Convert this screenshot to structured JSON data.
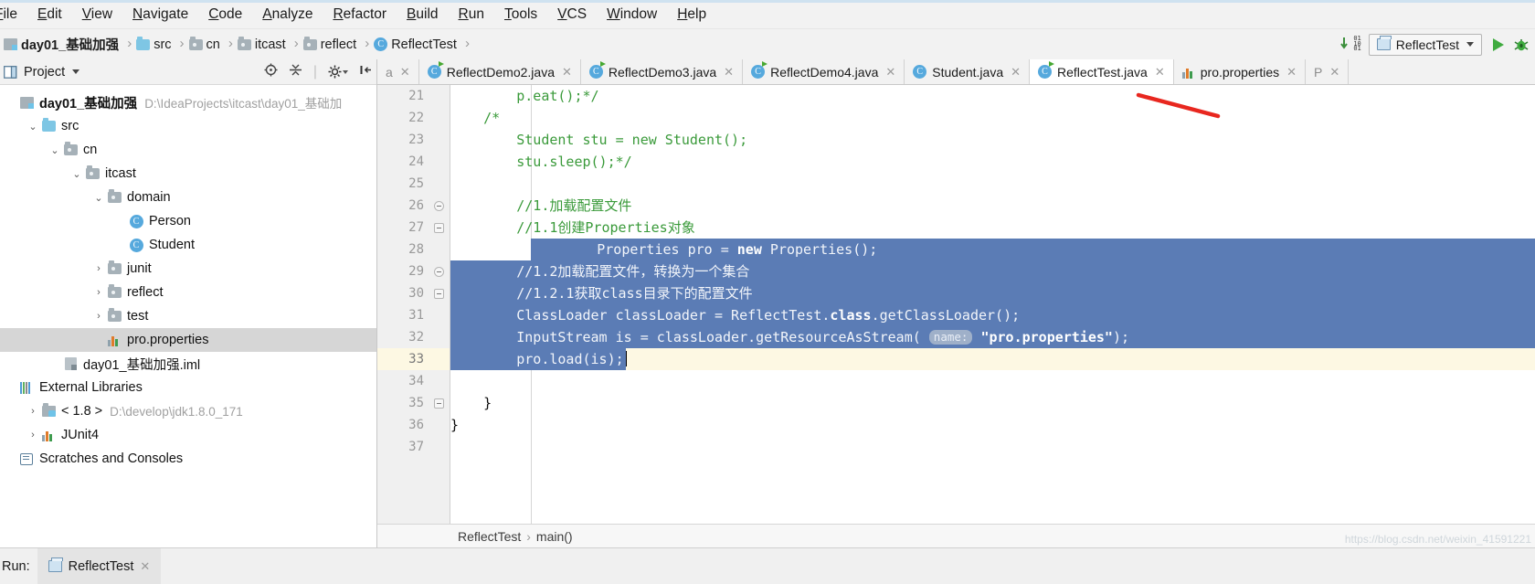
{
  "menu": {
    "items": [
      "File",
      "Edit",
      "View",
      "Navigate",
      "Code",
      "Analyze",
      "Refactor",
      "Build",
      "Run",
      "Tools",
      "VCS",
      "Window",
      "Help"
    ]
  },
  "navbar": {
    "crumbs": [
      {
        "label": "day01_基础加强",
        "icon": "module-icon",
        "bold": true
      },
      {
        "label": "src",
        "icon": "source-folder-icon",
        "bold": false
      },
      {
        "label": "cn",
        "icon": "package-icon",
        "bold": false
      },
      {
        "label": "itcast",
        "icon": "package-icon",
        "bold": false
      },
      {
        "label": "reflect",
        "icon": "package-icon",
        "bold": false
      },
      {
        "label": "ReflectTest",
        "icon": "java-class-icon",
        "bold": false
      }
    ],
    "compile_icon": "compile-icon",
    "run_config": "ReflectTest",
    "run_icon": "run-icon",
    "debug_icon": "debug-icon"
  },
  "project_panel": {
    "title": "Project",
    "toolbar_icons": [
      "locate-icon",
      "collapse-all-icon",
      "settings-icon",
      "hide-icon"
    ],
    "tree": [
      {
        "label": "day01_基础加强",
        "path": "D:\\IdeaProjects\\itcast\\day01_基础加",
        "indent": 0,
        "arrow": "",
        "icon": "module-icon",
        "bold": true,
        "selected": false
      },
      {
        "label": "src",
        "path": "",
        "indent": 1,
        "arrow": "v",
        "icon": "source-folder-icon",
        "bold": false,
        "selected": false
      },
      {
        "label": "cn",
        "path": "",
        "indent": 2,
        "arrow": "v",
        "icon": "package-icon",
        "bold": false,
        "selected": false
      },
      {
        "label": "itcast",
        "path": "",
        "indent": 3,
        "arrow": "v",
        "icon": "package-icon",
        "bold": false,
        "selected": false
      },
      {
        "label": "domain",
        "path": "",
        "indent": 4,
        "arrow": "v",
        "icon": "package-icon",
        "bold": false,
        "selected": false
      },
      {
        "label": "Person",
        "path": "",
        "indent": 5,
        "arrow": "",
        "icon": "java-class-icon",
        "bold": false,
        "selected": false
      },
      {
        "label": "Student",
        "path": "",
        "indent": 5,
        "arrow": "",
        "icon": "java-class-icon",
        "bold": false,
        "selected": false
      },
      {
        "label": "junit",
        "path": "",
        "indent": 4,
        "arrow": ">",
        "icon": "package-icon",
        "bold": false,
        "selected": false
      },
      {
        "label": "reflect",
        "path": "",
        "indent": 4,
        "arrow": ">",
        "icon": "package-icon",
        "bold": false,
        "selected": false
      },
      {
        "label": "test",
        "path": "",
        "indent": 4,
        "arrow": ">",
        "icon": "package-icon",
        "bold": false,
        "selected": false
      },
      {
        "label": "pro.properties",
        "path": "",
        "indent": 4,
        "arrow": "",
        "icon": "properties-icon",
        "bold": false,
        "selected": true
      },
      {
        "label": "day01_基础加强.iml",
        "path": "",
        "indent": 2,
        "arrow": "",
        "icon": "iml-icon",
        "bold": false,
        "selected": false
      },
      {
        "label": "External Libraries",
        "path": "",
        "indent": 0,
        "arrow": "",
        "icon": "libraries-icon",
        "bold": false,
        "selected": false
      },
      {
        "label": "< 1.8 >",
        "path": "D:\\develop\\jdk1.8.0_171",
        "indent": 1,
        "arrow": ">",
        "icon": "jdk-icon",
        "bold": false,
        "selected": false
      },
      {
        "label": "JUnit4",
        "path": "",
        "indent": 1,
        "arrow": ">",
        "icon": "library-icon",
        "bold": false,
        "selected": false
      },
      {
        "label": "Scratches and Consoles",
        "path": "",
        "indent": 0,
        "arrow": "",
        "icon": "scratches-icon",
        "bold": false,
        "selected": false
      }
    ]
  },
  "editor": {
    "tabs": [
      {
        "label": "a",
        "icon": "java-class-icon",
        "active": false,
        "partial": true
      },
      {
        "label": "ReflectDemo2.java",
        "icon": "java-run-class-icon",
        "active": false,
        "partial": false
      },
      {
        "label": "ReflectDemo3.java",
        "icon": "java-run-class-icon",
        "active": false,
        "partial": false
      },
      {
        "label": "ReflectDemo4.java",
        "icon": "java-run-class-icon",
        "active": false,
        "partial": false
      },
      {
        "label": "Student.java",
        "icon": "java-class-icon",
        "active": false,
        "partial": false
      },
      {
        "label": "ReflectTest.java",
        "icon": "java-run-class-icon",
        "active": true,
        "partial": false
      },
      {
        "label": "pro.properties",
        "icon": "properties-icon",
        "active": false,
        "partial": false
      },
      {
        "label": "P",
        "icon": "java-class-icon",
        "active": false,
        "partial": true
      }
    ],
    "first_line_number": 21,
    "lines": [
      {
        "num": 21,
        "text": "        p.eat();*/",
        "kind": "comment-tail",
        "fold": "",
        "selected": false,
        "caret": false
      },
      {
        "num": 22,
        "text": "    /*",
        "kind": "comment",
        "fold": "",
        "selected": false,
        "caret": false
      },
      {
        "num": 23,
        "text": "        Student stu = new Student();",
        "kind": "comment",
        "fold": "",
        "selected": false,
        "caret": false
      },
      {
        "num": 24,
        "text": "        stu.sleep();*/",
        "kind": "comment",
        "fold": "",
        "selected": false,
        "caret": false
      },
      {
        "num": 25,
        "text": "",
        "kind": "blank",
        "fold": "",
        "selected": false,
        "caret": false
      },
      {
        "num": 26,
        "text": "        //1.加载配置文件",
        "kind": "comment",
        "fold": "round",
        "selected": false,
        "caret": false
      },
      {
        "num": 27,
        "text": "        //1.1创建Properties对象",
        "kind": "comment",
        "fold": "square",
        "selected": false,
        "caret": false
      },
      {
        "num": 28,
        "text": "        Properties pro = new Properties();",
        "kind": "code",
        "fold": "",
        "selected": true,
        "caret": false
      },
      {
        "num": 29,
        "text": "        //1.2加载配置文件，转换为一个集合",
        "kind": "comment",
        "fold": "round",
        "selected": true,
        "caret": false
      },
      {
        "num": 30,
        "text": "        //1.2.1获取class目录下的配置文件",
        "kind": "comment",
        "fold": "square",
        "selected": true,
        "caret": false
      },
      {
        "num": 31,
        "text": "        ClassLoader classLoader = ReflectTest.class.getClassLoader();",
        "kind": "code",
        "fold": "",
        "selected": true,
        "caret": false
      },
      {
        "num": 32,
        "text": "        InputStream is = classLoader.getResourceAsStream( name: \"pro.properties\");",
        "kind": "code",
        "fold": "",
        "selected": true,
        "caret": false
      },
      {
        "num": 33,
        "text": "        pro.load(is);",
        "kind": "code",
        "fold": "",
        "selected": true,
        "caret": true
      },
      {
        "num": 34,
        "text": "",
        "kind": "blank",
        "fold": "",
        "selected": false,
        "caret": false
      },
      {
        "num": 35,
        "text": "    }",
        "kind": "code",
        "fold": "square",
        "selected": false,
        "caret": false
      },
      {
        "num": 36,
        "text": "}",
        "kind": "code",
        "fold": "",
        "selected": false,
        "caret": false
      },
      {
        "num": 37,
        "text": "",
        "kind": "blank",
        "fold": "",
        "selected": false,
        "caret": false
      }
    ],
    "param_hint": "name:",
    "breadcrumb": [
      "ReflectTest",
      "main()"
    ],
    "breadcrumb_separator": "›"
  },
  "bottom": {
    "run_label": "Run:",
    "run_tab": "ReflectTest",
    "run_tab_icon": "run-window-icon"
  },
  "annotation": {
    "red_stroke": "red-underline-mark",
    "color": "#e8271f"
  },
  "watermark": "https://blog.csdn.net/weixin_41591221",
  "colors": {
    "selection_blue": "#5b7cb5",
    "caret_line_yellow": "#fdf8e3",
    "comment_green": "#3a9a3a",
    "keyword_blue": "#0033b3",
    "string_green": "#067d17",
    "accent_green": "#46a832"
  }
}
